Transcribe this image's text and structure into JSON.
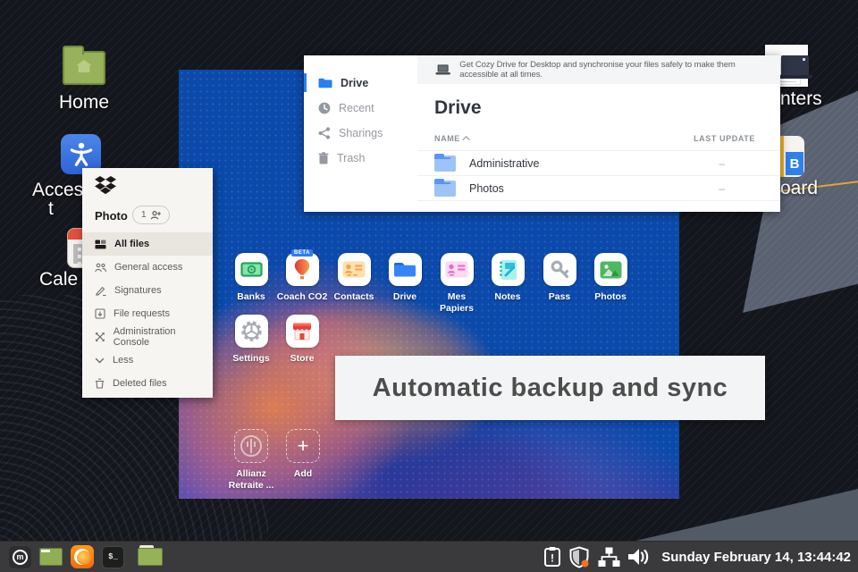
{
  "colors": {
    "cozy_blue": "#0b4aab",
    "cozy_accent": "#297ef2",
    "dropbox_bg": "#f7f5f2",
    "taskbar_bg": "#3a3a3c",
    "wallpaper_band": "#5a6170"
  },
  "desktop": {
    "icons": [
      {
        "name": "home",
        "label": "Home",
        "icon": "home-folder-icon"
      },
      {
        "name": "accessibility",
        "label": "Acces",
        "label2": "t",
        "icon": "accessibility-icon"
      },
      {
        "name": "calendar",
        "label": "Cale",
        "icon": "calendar-icon"
      },
      {
        "name": "printers-partial",
        "label": "nters"
      },
      {
        "name": "board-partial",
        "label": "oard",
        "icon": "book-b-icon",
        "icon_letter": "B"
      }
    ]
  },
  "cozy_home": {
    "apps": [
      {
        "label": "Banks",
        "icon": "banknote-icon"
      },
      {
        "label": "Coach CO2",
        "icon": "balloon-icon",
        "badge": "BETA"
      },
      {
        "label": "Contacts",
        "icon": "contact-card-icon"
      },
      {
        "label": "Drive",
        "icon": "folder-icon"
      },
      {
        "label": "Mes Papiers",
        "icon": "papers-card-icon"
      },
      {
        "label": "Notes",
        "icon": "notepad-icon"
      },
      {
        "label": "Pass",
        "icon": "key-icon"
      },
      {
        "label": "Photos",
        "icon": "photo-icon"
      },
      {
        "label": "Settings",
        "icon": "gear-icon"
      },
      {
        "label": "Store",
        "icon": "storefront-icon"
      }
    ],
    "shortcuts": [
      {
        "label_line1": "Allianz",
        "label_line2": "Retraite ...",
        "icon": "allianz-logo-icon"
      },
      {
        "label_line1": "Add",
        "label_line2": "",
        "icon": "plus-icon"
      }
    ]
  },
  "drive_window": {
    "sidebar": [
      {
        "label": "Drive",
        "icon": "folder-icon",
        "active": true
      },
      {
        "label": "Recent",
        "icon": "clock-icon",
        "active": false
      },
      {
        "label": "Sharings",
        "icon": "share-icon",
        "active": false
      },
      {
        "label": "Trash",
        "icon": "trash-icon",
        "active": false
      }
    ],
    "banner_text": "Get Cozy Drive for Desktop and synchronise your files safely to make them accessible at all times.",
    "title": "Drive",
    "columns": {
      "name": "NAME",
      "last_update": "LAST UPDATE"
    },
    "rows": [
      {
        "name": "Administrative",
        "last_update": "–",
        "icon": "folder-icon"
      },
      {
        "name": "Photos",
        "last_update": "–",
        "icon": "folder-icon"
      }
    ]
  },
  "dropbox_panel": {
    "logo": "dropbox-logo-icon",
    "workspace": "Photo",
    "member_count": "1",
    "items": [
      {
        "label": "All files",
        "icon": "files-icon",
        "active": true
      },
      {
        "label": "General access",
        "icon": "people-icon",
        "active": false
      },
      {
        "label": "Signatures",
        "icon": "pen-icon",
        "active": false
      },
      {
        "label": "File requests",
        "icon": "file-request-icon",
        "active": false
      },
      {
        "label": "Administration Console",
        "icon": "admin-arrows-icon",
        "active": false
      },
      {
        "label": "Less",
        "icon": "chevron-down-icon",
        "active": false
      },
      {
        "label": "Deleted files",
        "icon": "trash-icon",
        "active": false
      }
    ]
  },
  "slogan": "Automatic backup and sync",
  "taskbar": {
    "launchers": [
      "menu",
      "window",
      "firefox",
      "terminal",
      "file-manager"
    ],
    "tray": [
      "clipboard",
      "shield",
      "network",
      "volume"
    ],
    "terminal_glyph": "$_",
    "menu_glyph": "m",
    "clock": "Sunday February 14, 13:44:42"
  }
}
